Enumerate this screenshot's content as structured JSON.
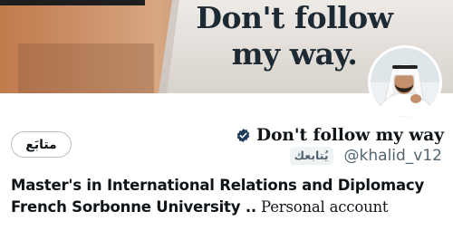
{
  "banner": {
    "quote_line1": "Don't follow",
    "quote_line2": "my way."
  },
  "profile": {
    "display_name": "Don't follow my way",
    "handle": "@khalid_v12",
    "follows_you_label": "يُتابعك",
    "follow_button_label": "متابَع",
    "verified_color": "#1d3b5a",
    "bio_line1": "Master's in International Relations and Diplomacy",
    "bio_line2_bold": "French Sorbonne University ..",
    "bio_line2_tail": " Personal account"
  },
  "icons": {
    "verified": "verified-badge-icon",
    "avatar": "profile-avatar"
  }
}
